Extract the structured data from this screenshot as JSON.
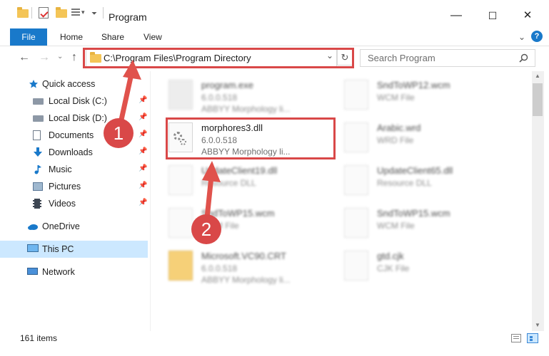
{
  "window": {
    "title": "Program",
    "minimize": "—",
    "maximize": "☐",
    "close": "✕",
    "help": "?"
  },
  "ribbon": {
    "tabs": [
      "File",
      "Home",
      "Share",
      "View"
    ],
    "expand": "⌄"
  },
  "nav": {
    "back": "←",
    "forward": "→",
    "recent": "⌄",
    "up": "↑",
    "address": "C:\\Program Files\\Program Directory",
    "address_dropdown": "⌄",
    "refresh": "↻",
    "search_placeholder": "Search Program"
  },
  "sidebar": {
    "items": [
      {
        "label": "Quick access",
        "icon": "star-icon"
      },
      {
        "label": "Local Disk (C:)",
        "icon": "drive-icon",
        "pinned": true
      },
      {
        "label": "Local Disk (D:)",
        "icon": "drive-icon",
        "pinned": true
      },
      {
        "label": "Documents",
        "icon": "documents-icon",
        "pinned": true
      },
      {
        "label": "Downloads",
        "icon": "downloads-icon",
        "pinned": true
      },
      {
        "label": "Music",
        "icon": "music-icon",
        "pinned": true
      },
      {
        "label": "Pictures",
        "icon": "pictures-icon",
        "pinned": true
      },
      {
        "label": "Videos",
        "icon": "videos-icon",
        "pinned": true
      },
      {
        "label": "OneDrive",
        "icon": "cloud-icon"
      },
      {
        "label": "This PC",
        "icon": "computer-icon",
        "selected": true
      },
      {
        "label": "Network",
        "icon": "network-icon"
      }
    ]
  },
  "files": {
    "left": [
      {
        "name": "program.exe",
        "line2": "6.0.0.518",
        "line3": "ABBYY Morphology li...",
        "blurred": true
      },
      {
        "name": "morphores3.dll",
        "line2": "6.0.0.518",
        "line3": "ABBYY Morphology li...",
        "blurred": false
      },
      {
        "name": "UpdateClient19.dll",
        "line2": "Resource DLL",
        "line3": "",
        "blurred": true
      },
      {
        "name": "SndToWP15.wcm",
        "line2": "WCM File",
        "line3": "",
        "blurred": true
      },
      {
        "name": "Microsoft.VC90.CRT",
        "line2": "6.0.0.518",
        "line3": "ABBYY Morphology li...",
        "blurred": true
      }
    ],
    "right": [
      {
        "name": "SndToWP12.wcm",
        "line2": "WCM File",
        "line3": ""
      },
      {
        "name": "Arabic.wrd",
        "line2": "WRD File",
        "line3": ""
      },
      {
        "name": "UpdateClient65.dll",
        "line2": "Resource DLL",
        "line3": ""
      },
      {
        "name": "SndToWP15.wcm",
        "line2": "WCM File",
        "line3": ""
      },
      {
        "name": "gtd.cjk",
        "line2": "CJK File",
        "line3": ""
      }
    ]
  },
  "status": {
    "count": "161 items"
  },
  "annotations": {
    "step1": "1",
    "step2": "2"
  },
  "colors": {
    "accent": "#1979ca",
    "highlight": "#d94848",
    "selected_bg": "#cce8ff"
  }
}
